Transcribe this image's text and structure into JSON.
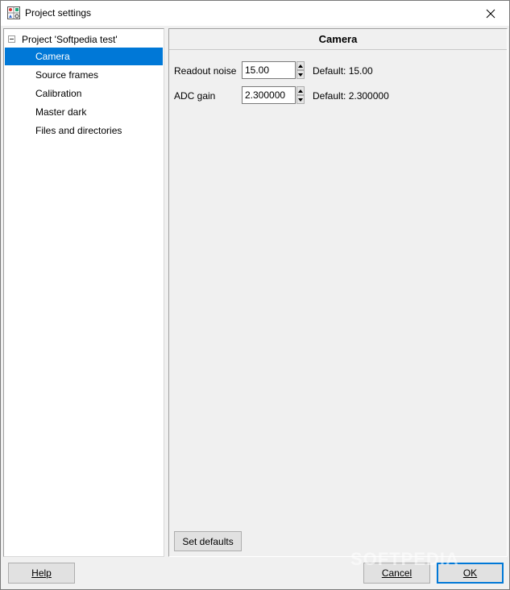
{
  "window": {
    "title": "Project settings"
  },
  "tree": {
    "root_label": "Project 'Softpedia test'",
    "items": [
      {
        "label": "Camera",
        "selected": true
      },
      {
        "label": "Source frames",
        "selected": false
      },
      {
        "label": "Calibration",
        "selected": false
      },
      {
        "label": "Master dark",
        "selected": false
      },
      {
        "label": "Files and directories",
        "selected": false
      }
    ]
  },
  "panel": {
    "title": "Camera",
    "fields": {
      "readout_noise": {
        "label": "Readout noise",
        "value": "15.00",
        "default_text": "Default: 15.00"
      },
      "adc_gain": {
        "label": "ADC gain",
        "value": "2.300000",
        "default_text": "Default: 2.300000"
      }
    },
    "set_defaults_label": "Set defaults"
  },
  "footer": {
    "help_label": "Help",
    "cancel_label": "Cancel",
    "ok_label": "OK"
  },
  "watermark": "SOFTPEDIA",
  "colors": {
    "selection": "#0078d7",
    "window_bg": "#f0f0f0",
    "button_bg": "#e1e1e1"
  },
  "icons": {
    "app": "settings-grid-icon",
    "close": "close-icon",
    "spin_up": "triangle-up-icon",
    "spin_down": "triangle-down-icon",
    "tree_expander": "minus-box-icon"
  }
}
